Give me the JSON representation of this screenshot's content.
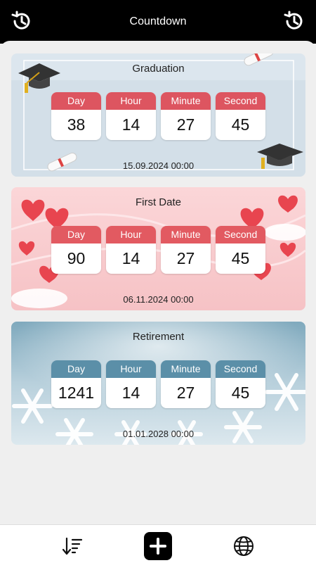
{
  "header": {
    "title": "Countdown",
    "left_icon": "history-icon",
    "right_icon": "history-icon"
  },
  "countdowns": [
    {
      "name": "Graduation",
      "theme": "graduation",
      "accent": "#dd5560",
      "units": [
        {
          "label": "Day",
          "value": "38"
        },
        {
          "label": "Hour",
          "value": "14"
        },
        {
          "label": "Minute",
          "value": "27"
        },
        {
          "label": "Second",
          "value": "45"
        }
      ],
      "date": "15.09.2024 00:00"
    },
    {
      "name": "First Date",
      "theme": "hearts",
      "accent": "#e25a61",
      "units": [
        {
          "label": "Day",
          "value": "90"
        },
        {
          "label": "Hour",
          "value": "14"
        },
        {
          "label": "Minute",
          "value": "27"
        },
        {
          "label": "Second",
          "value": "45"
        }
      ],
      "date": "06.11.2024 00:00"
    },
    {
      "name": "Retirement",
      "theme": "winter",
      "accent": "#5b8fa8",
      "units": [
        {
          "label": "Day",
          "value": "1241"
        },
        {
          "label": "Hour",
          "value": "14"
        },
        {
          "label": "Minute",
          "value": "27"
        },
        {
          "label": "Second",
          "value": "45"
        }
      ],
      "date": "01.01.2028 00:00"
    }
  ],
  "bottom_nav": [
    {
      "icon": "sort-icon"
    },
    {
      "icon": "add-icon"
    },
    {
      "icon": "globe-icon"
    }
  ]
}
